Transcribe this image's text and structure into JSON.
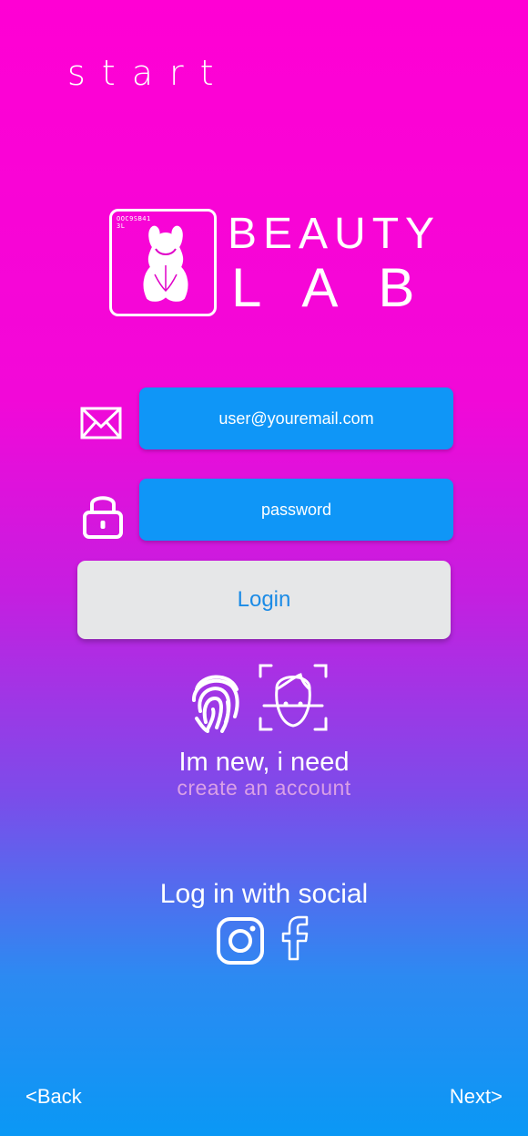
{
  "header": {
    "title": "START"
  },
  "logo": {
    "code_text": "OOC9SB41\n3L",
    "brand_line1": "BEAUTY",
    "brand_line2": "LAB"
  },
  "form": {
    "email_placeholder": "user@youremail.com",
    "password_placeholder": "password",
    "login_label": "Login"
  },
  "biometrics": {
    "fingerprint_icon": "fingerprint-icon",
    "face_icon": "face-id-icon"
  },
  "signup": {
    "prompt": "Im new, i need",
    "link": "create an account"
  },
  "social": {
    "title": "Log in with social",
    "icons": [
      "instagram-icon",
      "facebook-icon"
    ]
  },
  "nav": {
    "back": "<Back",
    "next": "Next>"
  },
  "colors": {
    "gradient_top": "#FF00D4",
    "gradient_bottom": "#0A98F5",
    "input_bg": "#0F96F7",
    "login_bg": "#E6E7E8",
    "login_text": "#1B8BE6",
    "link_color": "#D9A0E6"
  }
}
